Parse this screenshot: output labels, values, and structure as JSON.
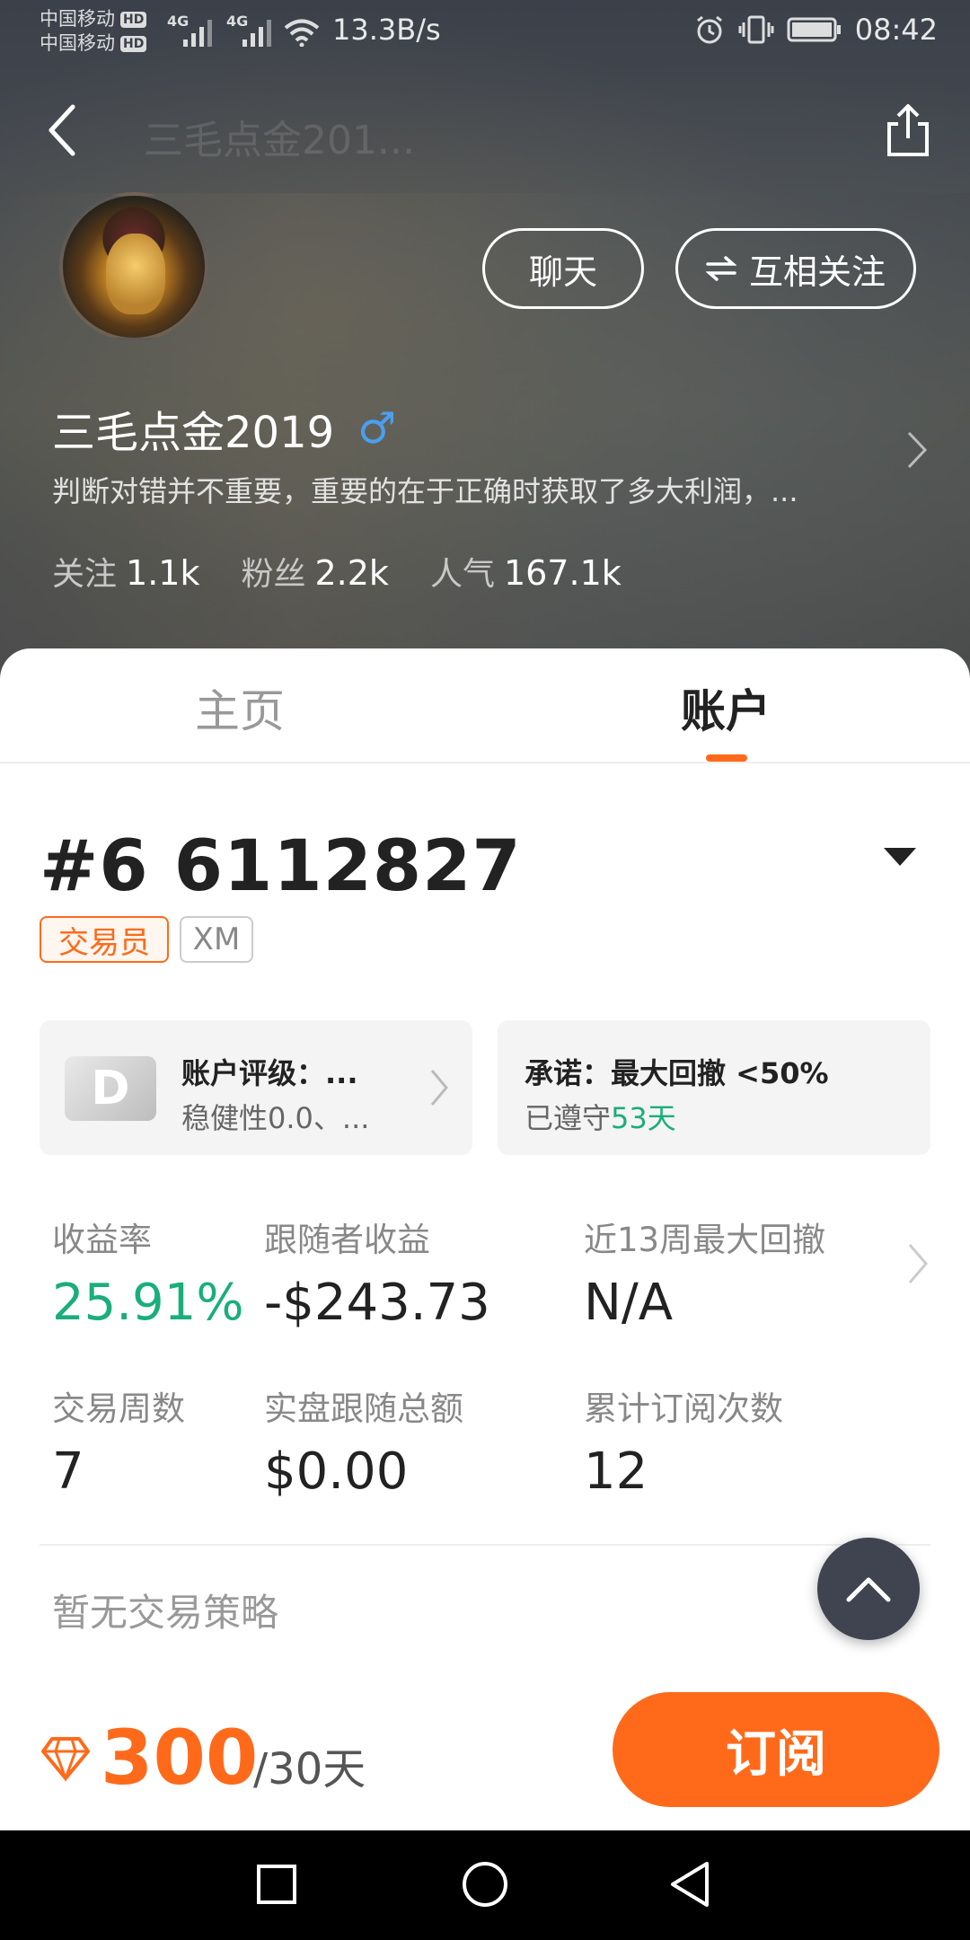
{
  "status_bar": {
    "carrier_1": "中国移动",
    "carrier_2": "中国移动",
    "hd_label": "HD",
    "signal_label": "4G",
    "net_speed": "13.3B/s",
    "time": "08:42"
  },
  "nav": {
    "ghost_title": "三毛点金201..."
  },
  "profile": {
    "chat_label": "聊天",
    "follow_label": "互相关注",
    "username": "三毛点金2019",
    "gender_symbol": "♂",
    "bio": "判断对错并不重要，重要的在于正确时获取了多大利润，...",
    "stats": [
      {
        "label": "关注",
        "value": "1.1k"
      },
      {
        "label": "粉丝",
        "value": "2.2k"
      },
      {
        "label": "人气",
        "value": "167.1k"
      }
    ]
  },
  "tabs": {
    "home": "主页",
    "account": "账户"
  },
  "account": {
    "id": "#6 6112827",
    "tag_role": "交易员",
    "tag_broker": "XM",
    "rating_grade": "D",
    "rating_title": "账户评级：...",
    "rating_sub": "稳健性0.0、...",
    "promise_title": "承诺：最大回撤 <50%",
    "promise_prefix": "已遵守",
    "promise_days": "53天"
  },
  "metrics": [
    {
      "label": "收益率",
      "value": "25.91%"
    },
    {
      "label": "跟随者收益",
      "value": "-$243.73"
    },
    {
      "label": "近13周最大回撤",
      "value": "N/A"
    },
    {
      "label": "交易周数",
      "value": "7"
    },
    {
      "label": "实盘跟随总额",
      "value": "$0.00"
    },
    {
      "label": "累计订阅次数",
      "value": "12"
    }
  ],
  "strategy_text": "暂无交易策略",
  "subscription": {
    "price": "300",
    "unit": "/30天",
    "button_label": "订阅"
  },
  "colors": {
    "accent": "#ff6a1a",
    "positive": "#1aae7a",
    "gender": "#4a9ff0"
  }
}
